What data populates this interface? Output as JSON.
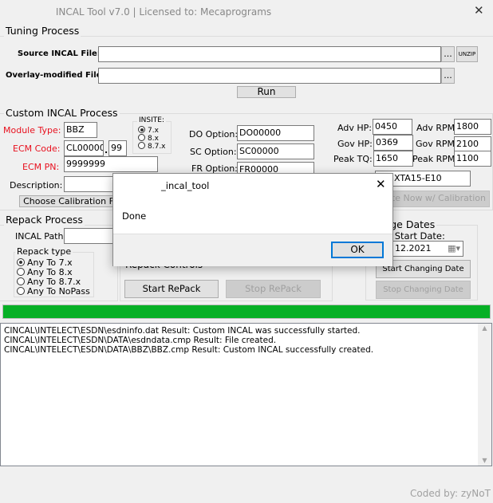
{
  "window": {
    "title": "INCAL Tool v7.0 | Licensed to: Mecaprograms",
    "close": "✕"
  },
  "tuning": {
    "group": "Tuning Process",
    "source_label": "Source INCAL File:",
    "source_value": "",
    "overlay_label": "Overlay-modified File:",
    "overlay_value": "",
    "browse": "...",
    "unzip": "UNZIP",
    "run": "Run"
  },
  "custom": {
    "group": "Custom INCAL Process",
    "module_type_label": "Module Type:",
    "module_type": "BBZ",
    "ecm_code_label": "ECM Code:",
    "ecm_code": "CL00000",
    "ecm_code_sep": ".",
    "ecm_code_suffix": "99",
    "ecm_pn_label": "ECM PN:",
    "ecm_pn": "9999999",
    "description_label": "Description:",
    "description": "",
    "choose_calibration": "Choose Calibration F",
    "insite": {
      "label": "INSITE:",
      "options": [
        "7.x",
        "8.x",
        "8.7.x"
      ],
      "selected": 0
    },
    "do_label": "DO Option:",
    "do_value": "DO00000",
    "sc_label": "SC Option:",
    "sc_value": "SC00000",
    "fr_label": "FR Option:",
    "fr_value": "FR00000",
    "adv_hp_label": "Adv HP:",
    "adv_hp": "0450",
    "gov_hp_label": "Gov HP:",
    "gov_hp": "0369",
    "peak_tq_label": "Peak TQ:",
    "peak_tq": "1650",
    "adv_rpm_label": "Adv RPM:",
    "adv_rpm": "1800",
    "gov_rpm_label": "Gov RPM:",
    "gov_rpm": "2100",
    "peak_rpm_label": "Peak RPM:",
    "peak_rpm": "1100",
    "engine": "XTA15-E10",
    "create_now": "Create Now w/ Calibration"
  },
  "repack": {
    "group": "Repack Process",
    "path_label": "INCAL Path:",
    "path_value": "",
    "type_label": "Repack type",
    "types": [
      "Any To 7.x",
      "Any To 8.x",
      "Any To 8.7.x",
      "Any To NoPass"
    ],
    "selected": 0,
    "controls_label": "Repack Controls",
    "start": "Start RePack",
    "stop": "Stop RePack"
  },
  "dates": {
    "group": "Change Dates",
    "start_label": "New Start Date:",
    "date_value": "12.2021",
    "start": "Start Changing Date",
    "stop": "Stop Changing Date"
  },
  "progress": {
    "percent": 100,
    "color": "#06b025"
  },
  "log": [
    "CINCAL\\INTELECT\\ESDN\\esdninfo.dat Result: Custom INCAL was successfully started.",
    "CINCAL\\INTELECT\\ESDN\\DATA\\esdndata.cmp Result: File created.",
    "CINCAL\\INTELECT\\ESDN\\DATA\\BBZ\\BBZ.cmp Result: Custom INCAL successfully created."
  ],
  "footer": "Coded by: zyNoT",
  "dialog": {
    "title": "_incal_tool",
    "message": "Done",
    "ok": "OK",
    "close": "✕"
  }
}
